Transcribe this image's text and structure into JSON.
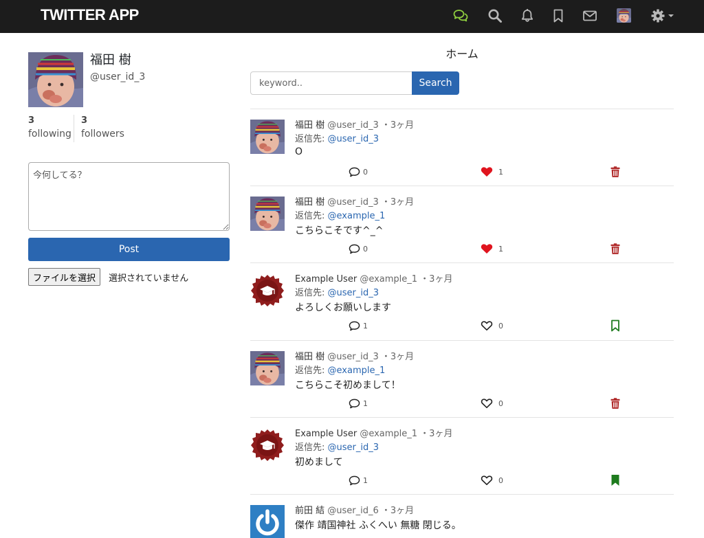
{
  "app": {
    "brand": "TWITTER APP"
  },
  "nav": {
    "icons": [
      "chat-bubbles-icon",
      "search-icon",
      "bell-icon",
      "bookmark-icon",
      "mail-icon",
      "avatar",
      "gear-icon"
    ]
  },
  "colors": {
    "nav_bg": "#1c1c1c",
    "nav_active": "#8fce3f",
    "primary": "#2a66b0",
    "like_red": "#e0141e",
    "delete_red": "#b02a2a",
    "bookmark_green": "#1e7b1e"
  },
  "profile": {
    "name": "福田 樹",
    "handle": "@user_id_3",
    "following_count": "3",
    "following_label": "following",
    "followers_count": "3",
    "followers_label": "followers"
  },
  "compose": {
    "placeholder": "今何してる？",
    "post_label": "Post",
    "file_button": "ファイルを選択",
    "file_status": "選択されていません"
  },
  "main": {
    "title": "ホーム",
    "search_placeholder": "keyword..",
    "search_button": "Search"
  },
  "tweets": [
    {
      "name": "福田 樹",
      "meta": "@user_id_3 ・3ヶ月",
      "reply_prefix": "返信先:",
      "reply_to": "@user_id_3",
      "text": "O",
      "replies": "0",
      "likes": "1",
      "liked": true,
      "action": "delete"
    },
    {
      "name": "福田 樹",
      "meta": "@user_id_3 ・3ヶ月",
      "reply_prefix": "返信先:",
      "reply_to": "@example_1",
      "text": "こちらこそです^_^",
      "replies": "0",
      "likes": "1",
      "liked": true,
      "action": "delete"
    },
    {
      "name": "Example User",
      "meta": "@example_1 ・3ヶ月",
      "reply_prefix": "返信先:",
      "reply_to": "@user_id_3",
      "text": "よろしくお願いします",
      "replies": "1",
      "likes": "0",
      "liked": false,
      "action": "bookmark"
    },
    {
      "name": "福田 樹",
      "meta": "@user_id_3 ・3ヶ月",
      "reply_prefix": "返信先:",
      "reply_to": "@example_1",
      "text": "こちらこそ初めまして！",
      "replies": "1",
      "likes": "0",
      "liked": false,
      "action": "delete"
    },
    {
      "name": "Example User",
      "meta": "@example_1 ・3ヶ月",
      "reply_prefix": "返信先:",
      "reply_to": "@user_id_3",
      "text": "初めまして",
      "replies": "1",
      "likes": "0",
      "liked": false,
      "action": "bookmarked"
    },
    {
      "name": "前田 結",
      "meta": "@user_id_6 ・3ヶ月",
      "text": "傑作 靖国神社 ふくへい 無糖 閉じる。"
    }
  ]
}
